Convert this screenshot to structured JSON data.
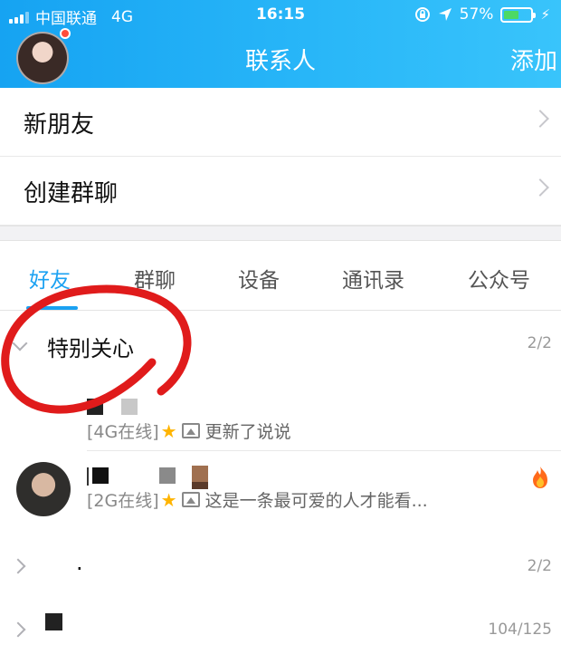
{
  "status_bar": {
    "carrier": "中国联通",
    "network": "4G",
    "time": "16:15",
    "battery": "57%",
    "battery_level": 0.57
  },
  "header": {
    "title": "联系人",
    "add_label": "添加"
  },
  "menu": {
    "new_friends": "新朋友",
    "create_group": "创建群聊"
  },
  "tabs": [
    {
      "label": "好友",
      "active": true
    },
    {
      "label": "群聊"
    },
    {
      "label": "设备"
    },
    {
      "label": "通讯录"
    },
    {
      "label": "公众号"
    }
  ],
  "groups": {
    "special": {
      "name": "特别关心",
      "count": "2/2"
    },
    "group2": {
      "name": ".",
      "count": "2/2"
    },
    "group3": {
      "count": "104/125"
    }
  },
  "friends": [
    {
      "online": "[4G在线]",
      "update": "更新了说说"
    },
    {
      "online": "[2G在线]",
      "update": "这是一条最可爱的人才能看..."
    }
  ],
  "colors": {
    "accent": "#1aa1f2",
    "header_start": "#16a3f2",
    "annotation": "#e01b1b"
  }
}
